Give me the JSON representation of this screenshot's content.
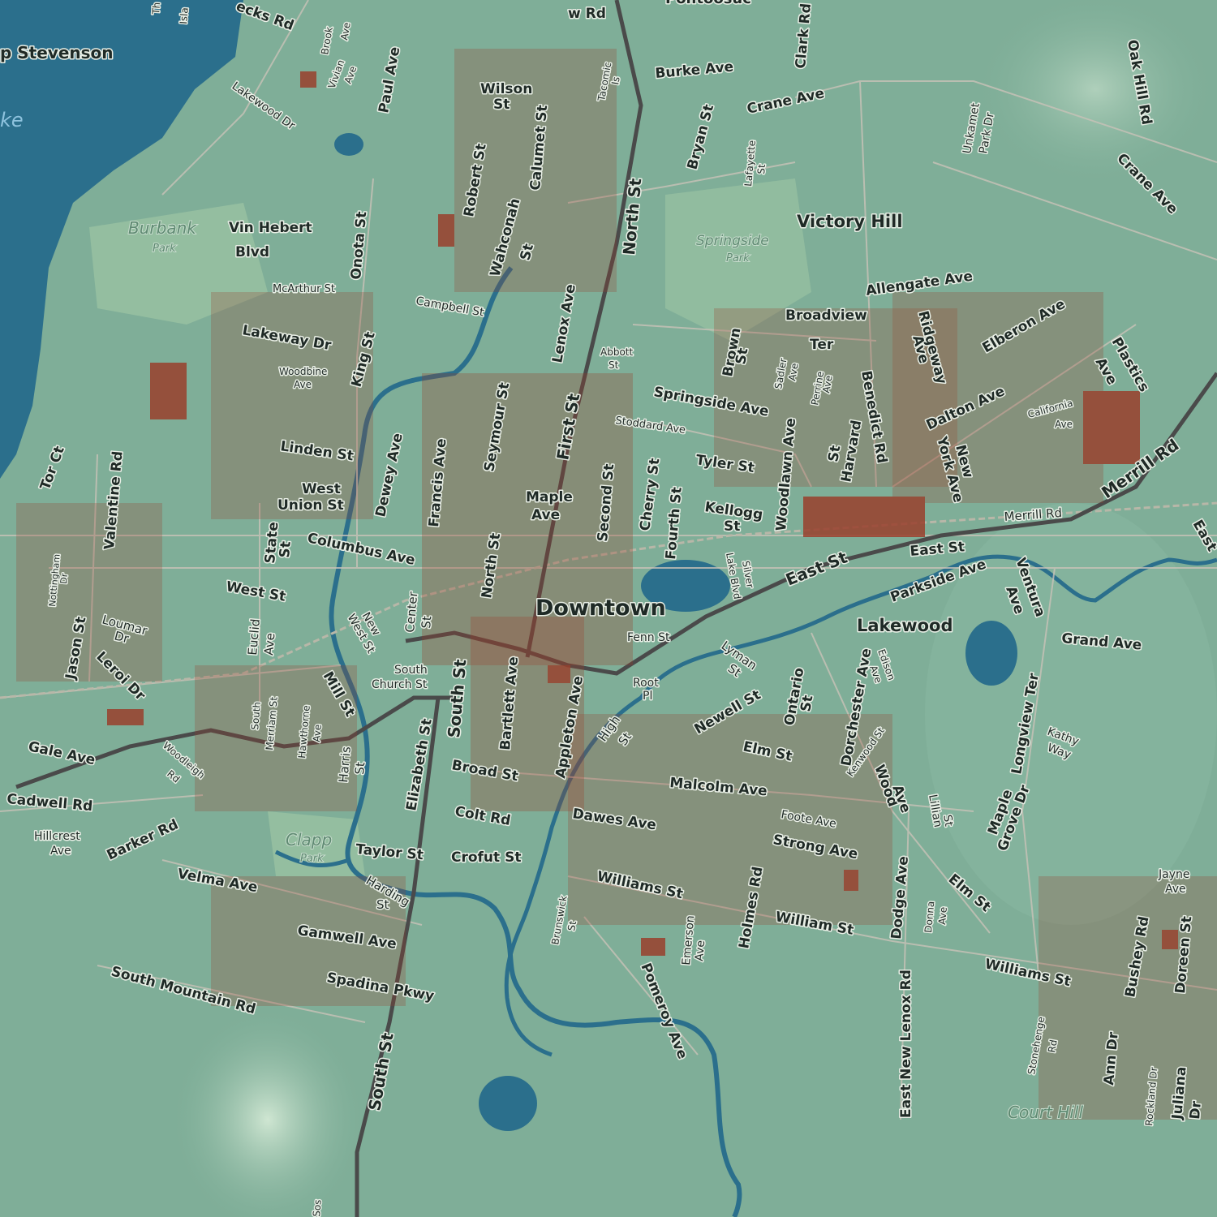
{
  "map": {
    "colors": {
      "land": "#7fae98",
      "water": "#2b6f8c",
      "building": "#9a3f2c",
      "road": "#c9c2b8",
      "major_road": "#4a4a4a",
      "park": "#a9c9a8"
    },
    "places": {
      "downtown": "Downtown",
      "victory_hill": "Victory Hill",
      "lakewood": "Lakewood",
      "court_hill": "Court Hill"
    },
    "parks": {
      "burbank": "Burbank",
      "burbank_sub": "Park",
      "springside": "Springside",
      "springside_sub": "Park",
      "clapp": "Clapp",
      "clapp_sub": "Park"
    },
    "water": {
      "lake_fragment": "ke",
      "camp_stevenson": "p Stevenson"
    },
    "streets": {
      "north_st": "North St",
      "first_st": "First St",
      "south_st": "South St",
      "east_st": "East St",
      "merrill_rd": "Merrill Rd",
      "merrill_rd_2": "Merrill Rd",
      "east_st_2": "East St",
      "east_st_3": "East",
      "burke_ave": "Burke Ave",
      "crane_ave": "Crane Ave",
      "crane_ave_2": "Crane Ave",
      "clark_rd": "Clark Rd",
      "oak_hill_rd": "Oak Hill Rd",
      "unkamet_park": "Unkamet",
      "unkamet_park_2": "Park Dr",
      "bryan_st": "Bryan St",
      "lafayette": "Lafayette",
      "lafayette_2": "St",
      "wilson_st": "Wilson",
      "wilson_st_2": "St",
      "calumet_st": "Calumet St",
      "robert_st": "Robert St",
      "wahconah_st": "Wahconah",
      "wahconah_st_2": "St",
      "tacomic": "Tacomic",
      "tacomic_2": "Is",
      "onota_st": "Onota St",
      "vin_hebert": "Vin Hebert",
      "vin_hebert_2": "Blvd",
      "mcarthur_st": "McArthur St",
      "lakeway_dr": "Lakeway Dr",
      "king_st": "King St",
      "woodbine_ave": "Woodbine",
      "woodbine_ave_2": "Ave",
      "campbell_st": "Campbell St",
      "lenox_ave": "Lenox Ave",
      "abbott_st": "Abbott",
      "abbott_st_2": "St",
      "seymour_st": "Seymour St",
      "francis_ave": "Francis Ave",
      "dewey_ave": "Dewey Ave",
      "linden_st": "Linden St",
      "west_union_st": "West",
      "west_union_st_2": "Union St",
      "columbus_ave": "Columbus Ave",
      "state_st": "State",
      "state_st_2": "St",
      "west_st": "West St",
      "maple_ave": "Maple",
      "maple_ave_2": "Ave",
      "second_st": "Second St",
      "cherry_st": "Cherry St",
      "fourth_st": "Fourth St",
      "kellogg_st": "Kellogg",
      "kellogg_st_2": "St",
      "tyler_st": "Tyler St",
      "stoddard_ave": "Stoddard Ave",
      "springside_ave": "Springside Ave",
      "brown_st": "Brown",
      "brown_st_2": "St",
      "broadview_ter": "Broadview",
      "broadview_ter_2": "Ter",
      "sadler_ave": "Sadler",
      "sadler_ave_2": "Ave",
      "perrine_ave": "Perrine",
      "perrine_ave_2": "Ave",
      "woodlawn_ave": "Woodlawn Ave",
      "harvard_st": "Harvard",
      "harvard_st_2": "St",
      "benedict_rd": "Benedict Rd",
      "allengate_ave": "Allengate Ave",
      "ridgeway_ave": "Ridgeway",
      "ridgeway_ave_2": "Ave",
      "elberon_ave": "Elberon Ave",
      "dalton_ave": "Dalton Ave",
      "new_york_ave": "New",
      "new_york_ave_2": "York Ave",
      "plastics_ave": "Plastics",
      "plastics_ave_2": "Ave",
      "california_ave": "California",
      "california_ave_2": "Ave",
      "silver_lake_blvd": "Silver",
      "silver_lake_blvd_2": "Lake Blvd",
      "parkside_ave": "Parkside Ave",
      "ventura_ave": "Ventura",
      "ventura_ave_2": "Ave",
      "grand_ave": "Grand Ave",
      "north_st_2": "North St",
      "center_st": "Center",
      "center_st_2": "St",
      "west_st_2": "West St",
      "new_west_st": "New",
      "bartlett_ave": "Bartlett Ave",
      "appleton_ave": "Appleton Ave",
      "fenn_st": "Fenn St",
      "root_pl": "Root",
      "root_pl_2": "Pl",
      "lyman_st": "Lyman",
      "lyman_st_2": "St",
      "edison_ave": "Edison",
      "edison_ave_2": "Ave",
      "ontario_st": "Ontario",
      "ontario_st_2": "St",
      "dorchester_ave": "Dorchester Ave",
      "kenwood_st": "Kenwood St",
      "longview_ter": "Longview Ter",
      "kathy_way": "Kathy",
      "kathy_way_2": "Way",
      "newell_st": "Newell St",
      "high_st": "High",
      "high_st_2": "St",
      "elm_st": "Elm St",
      "elm_st_2": "Elm St",
      "malcolm_ave": "Malcolm Ave",
      "foote_ave": "Foote Ave",
      "wood_ave": "Wood",
      "wood_ave_2": "Ave",
      "lillian_st": "Lillian",
      "lillian_st_2": "St",
      "maple_grove_dr": "Maple",
      "maple_grove_dr_2": "Grove Dr",
      "strong_ave": "Strong Ave",
      "dawes_ave": "Dawes Ave",
      "holmes_rd": "Holmes Rd",
      "williams_st": "Williams St",
      "williams_st_2": "Williams St",
      "william_st": "William St",
      "dodge_ave": "Dodge Ave",
      "donna_ave": "Donna",
      "donna_ave_2": "Ave",
      "east_new_lenox_rd": "East New Lenox Rd",
      "jayne_ave": "Jayne",
      "jayne_ave_2": "Ave",
      "bushey_rd": "Bushey Rd",
      "doreen_st": "Doreen St",
      "stonehenge_rd": "Stonehenge",
      "stonehenge_rd_2": "Rd",
      "ann_dr": "Ann Dr",
      "rockland_dr": "Rockland Dr",
      "juliana_dr": "Juliana",
      "juliana_dr_2": "Dr",
      "emerson_ave": "Emerson",
      "emerson_ave_2": "Ave",
      "brunswick_st": "Brunswick",
      "brunswick_st_2": "St",
      "pomeroy_ave": "Pomeroy Ave",
      "south_church_st": "South",
      "south_church_st_2": "Church St",
      "mill_st": "Mill St",
      "elizabeth_st": "Elizabeth St",
      "harris_st": "Harris",
      "harris_st_2": "St",
      "hawthorne_ave": "Hawthorne",
      "hawthorne_ave_2": "Ave",
      "south_merriam_st": "South",
      "south_merriam_st_2": "Merriam St",
      "broad_st": "Broad St",
      "colt_rd": "Colt Rd",
      "crofut_st": "Crofut St",
      "taylor_st": "Taylor St",
      "harding_st": "Harding",
      "harding_st_2": "St",
      "euclid_ave": "Euclid",
      "euclid_ave_2": "Ave",
      "loumar_dr": "Loumar",
      "loumar_dr_2": "Dr",
      "leroi_dr": "Leroi Dr",
      "jason_st": "Jason St",
      "nottingham_dr": "Nottingham",
      "nottingham_dr_2": "Dr",
      "valentine_rd": "Valentine Rd",
      "tor_ct": "Tor Ct",
      "gale_ave": "Gale Ave",
      "woodleigh_rd": "Woodleigh",
      "woodleigh_rd_2": "Rd",
      "cadwell_rd": "Cadwell Rd",
      "barker_rd": "Barker Rd",
      "hillcrest_ave": "Hillcrest",
      "hillcrest_ave_2": "Ave",
      "velma_ave": "Velma Ave",
      "gamwell_ave": "Gamwell Ave",
      "spadina_pkwy": "Spadina Pkwy",
      "south_mountain_rd": "South Mountain Rd",
      "south_st_2": "South St",
      "lakewood_dr": "Lakewood Dr",
      "paul_ave": "Paul Ave",
      "vivian_ave": "Vivian",
      "vivian_ave_2": "Ave",
      "brook_ave": "Brook",
      "brook_ave_2": "Ave",
      "pecks_rd": "ecks Rd",
      "new_rd": "w Rd",
      "pontoosuc": "Pontoosuc",
      "island": "Isla",
      "the_frag": "Th",
      "sos_frag": "Sos"
    }
  }
}
